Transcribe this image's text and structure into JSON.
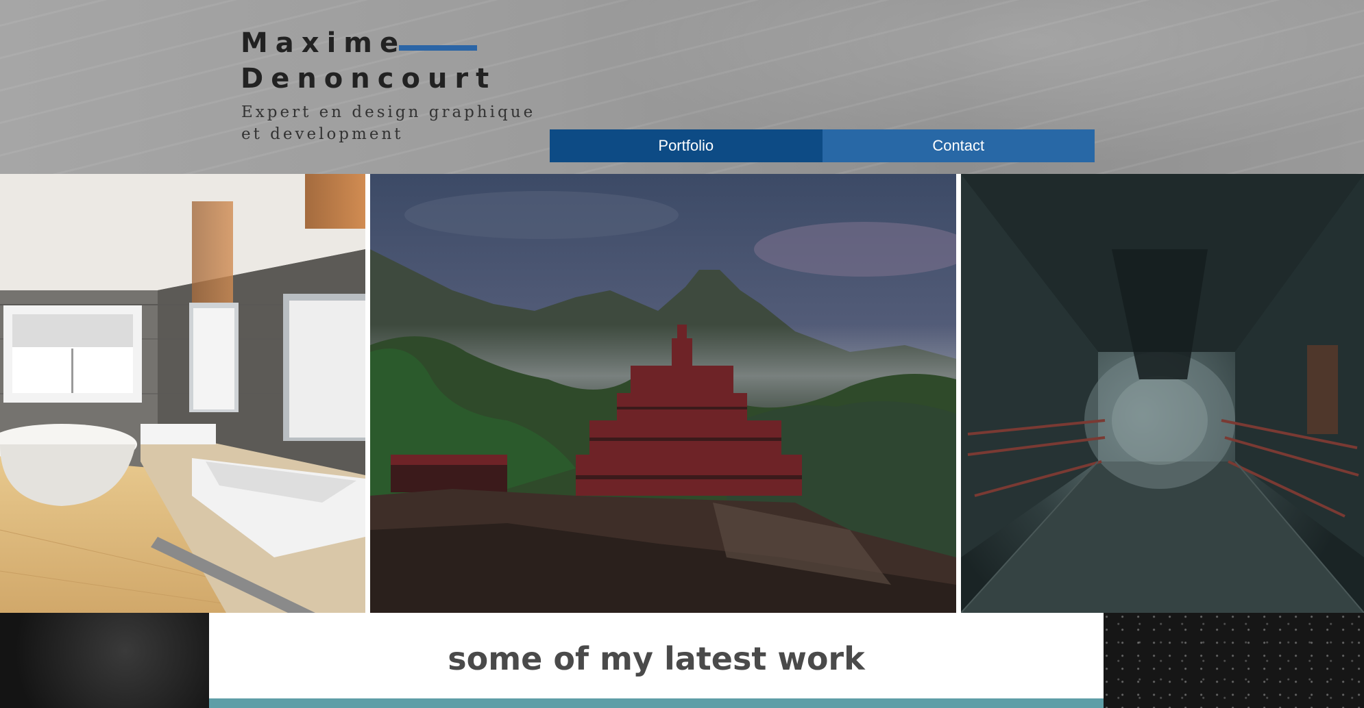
{
  "header": {
    "name_first": "Maxime",
    "name_last": "Denoncourt",
    "tagline": "Expert en design graphique et development"
  },
  "nav": {
    "items": [
      {
        "label": "Portfolio",
        "active": true
      },
      {
        "label": "Contact",
        "active": false
      }
    ]
  },
  "gallery": {
    "images": [
      {
        "subject": "bathroom interior render"
      },
      {
        "subject": "jungle temple on a mountain"
      },
      {
        "subject": "dark sci-fi corridor"
      }
    ]
  },
  "section": {
    "caption": "some of my latest work"
  },
  "colors": {
    "nav_active": "#0d4b85",
    "nav_normal": "#2868a6",
    "accent_rule": "#2b65a6",
    "caption_rule": "#5f9ea7"
  }
}
